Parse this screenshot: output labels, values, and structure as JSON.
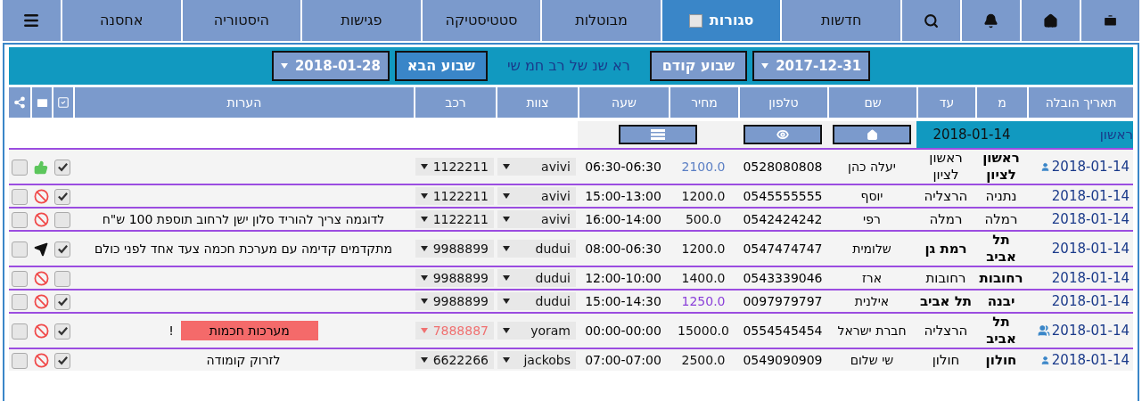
{
  "nav": {
    "tabs": [
      {
        "kind": "briefcase",
        "selected": false
      },
      {
        "kind": "home",
        "selected": false
      },
      {
        "kind": "bell",
        "selected": false
      },
      {
        "kind": "search",
        "selected": false
      },
      {
        "kind": "text",
        "label": "חדשות",
        "selected": false
      },
      {
        "kind": "text-box",
        "label": "סגורות",
        "selected": true
      },
      {
        "kind": "text",
        "label": "מבוטלות",
        "selected": false
      },
      {
        "kind": "text",
        "label": "סטטיסטיקה",
        "selected": false
      },
      {
        "kind": "text",
        "label": "פגישות",
        "selected": false
      },
      {
        "kind": "text",
        "label": "היסטוריה",
        "selected": false
      },
      {
        "kind": "text",
        "label": "אחסנה",
        "selected": false
      },
      {
        "kind": "menu",
        "selected": false
      }
    ]
  },
  "toolbar": {
    "from_date": "2017-12-31",
    "prev_button": "שבוע קודם",
    "week_days": "רא שנ של רב חמ שי",
    "next_button": "שבוע הבא",
    "to_date": "2018-01-28"
  },
  "table": {
    "columns": [
      "תאריך הובלה",
      "מ",
      "עד",
      "שם",
      "טלפון",
      "מחיר",
      "שעה",
      "צוות",
      "רכב",
      "הערות"
    ],
    "day": {
      "name": "ראשון",
      "date": "2018-01-14"
    },
    "rows": [
      {
        "date": "2018-01-14",
        "date_icon": {
          "kind": "person"
        },
        "from": {
          "text": "ראשון לציון",
          "bold": true
        },
        "to": {
          "text": "ראשון לציון",
          "bold": false
        },
        "name": "יעלה כהן",
        "phone": "0528080808",
        "price": {
          "text": "2100.0",
          "color": "#5b7fc4"
        },
        "time": "06:30-06:30",
        "team": "avivi",
        "car": "1122211",
        "car_alert": false,
        "notes": "",
        "approved": true,
        "status": {
          "kind": "like"
        },
        "selected": false
      },
      {
        "date": "2018-01-14",
        "from": {
          "text": "נתניה",
          "bold": false
        },
        "to": {
          "text": "הרצליה",
          "bold": false
        },
        "name": "יוסף",
        "phone": "0545555555",
        "price": {
          "text": "1200.0",
          "color": "#111111"
        },
        "time": "15:00-13:00",
        "team": "avivi",
        "car": "1122211",
        "car_alert": false,
        "notes": "",
        "approved": true,
        "status": {
          "kind": "ban"
        },
        "selected": false
      },
      {
        "date": "2018-01-14",
        "from": {
          "text": "רמלה",
          "bold": false
        },
        "to": {
          "text": "רמלה",
          "bold": false
        },
        "name": "רפי",
        "phone": "0542424242",
        "price": {
          "text": "500.0",
          "color": "#111111"
        },
        "time": "16:00-14:00",
        "team": "avivi",
        "car": "1122211",
        "car_alert": false,
        "notes": "לדוגמה צריך להוריד סלון ישן לרחוב תוספת 100 ש\"ח",
        "approved": false,
        "status": {
          "kind": "ban"
        },
        "selected": false
      },
      {
        "date": "2018-01-14",
        "from": {
          "text": "תל אביב",
          "bold": true
        },
        "to": {
          "text": "רמת גן",
          "bold": true
        },
        "name": "שלומית",
        "phone": "0547474747",
        "price": {
          "text": "1200.0",
          "color": "#111111"
        },
        "time": "08:00-06:30",
        "team": "dudui",
        "car": "9988899",
        "car_alert": false,
        "notes": "מתקדמים קדימה עם מערכת חכמה צעד אחד לפני כולם",
        "approved": true,
        "status": {
          "kind": "sent"
        },
        "selected": false
      },
      {
        "date": "2018-01-14",
        "from": {
          "text": "רחובות",
          "bold": true
        },
        "to": {
          "text": "רחובות",
          "bold": false
        },
        "name": "ארז",
        "phone": "0543339046",
        "price": {
          "text": "1400.0",
          "color": "#111111"
        },
        "time": "12:00-10:00",
        "team": "dudui",
        "car": "9988899",
        "car_alert": false,
        "notes": "",
        "approved": false,
        "status": {
          "kind": "ban"
        },
        "selected": false
      },
      {
        "date": "2018-01-14",
        "from": {
          "text": "יבנה",
          "bold": true
        },
        "to": {
          "text": "תל אביב",
          "bold": true
        },
        "name": "אילנית",
        "phone": "0097979797",
        "price": {
          "text": "1250.0",
          "color": "#8a3fd8"
        },
        "time": "15:00-14:30",
        "team": "dudui",
        "car": "9988899",
        "car_alert": false,
        "notes": "",
        "approved": true,
        "status": {
          "kind": "ban"
        },
        "selected": false
      },
      {
        "date": "2018-01-14",
        "date_icon": {
          "kind": "group"
        },
        "from": {
          "text": "תל אביב",
          "bold": true
        },
        "to": {
          "text": "הרצליה",
          "bold": false
        },
        "name": "חברת ישראל",
        "phone": "0554545454",
        "price": {
          "text": "15000.0",
          "color": "#111111"
        },
        "time": "00:00-00:00",
        "team": "yoram",
        "car": "7888887",
        "car_alert": true,
        "notes_badge": "מערכות חכמות",
        "notes": "!",
        "approved": true,
        "status": {
          "kind": "ban"
        },
        "selected": false
      },
      {
        "date": "2018-01-14",
        "date_icon": {
          "kind": "person"
        },
        "from": {
          "text": "חולון",
          "bold": true
        },
        "to": {
          "text": "חולון",
          "bold": false
        },
        "name": "שי שלום",
        "phone": "0549090909",
        "price": {
          "text": "2500.0",
          "color": "#111111"
        },
        "time": "07:00-07:00",
        "team": "jackobs",
        "car": "6622266",
        "car_alert": false,
        "notes": "לזרוק קומודה",
        "approved": true,
        "status": {
          "kind": "ban"
        },
        "selected": false
      }
    ]
  }
}
